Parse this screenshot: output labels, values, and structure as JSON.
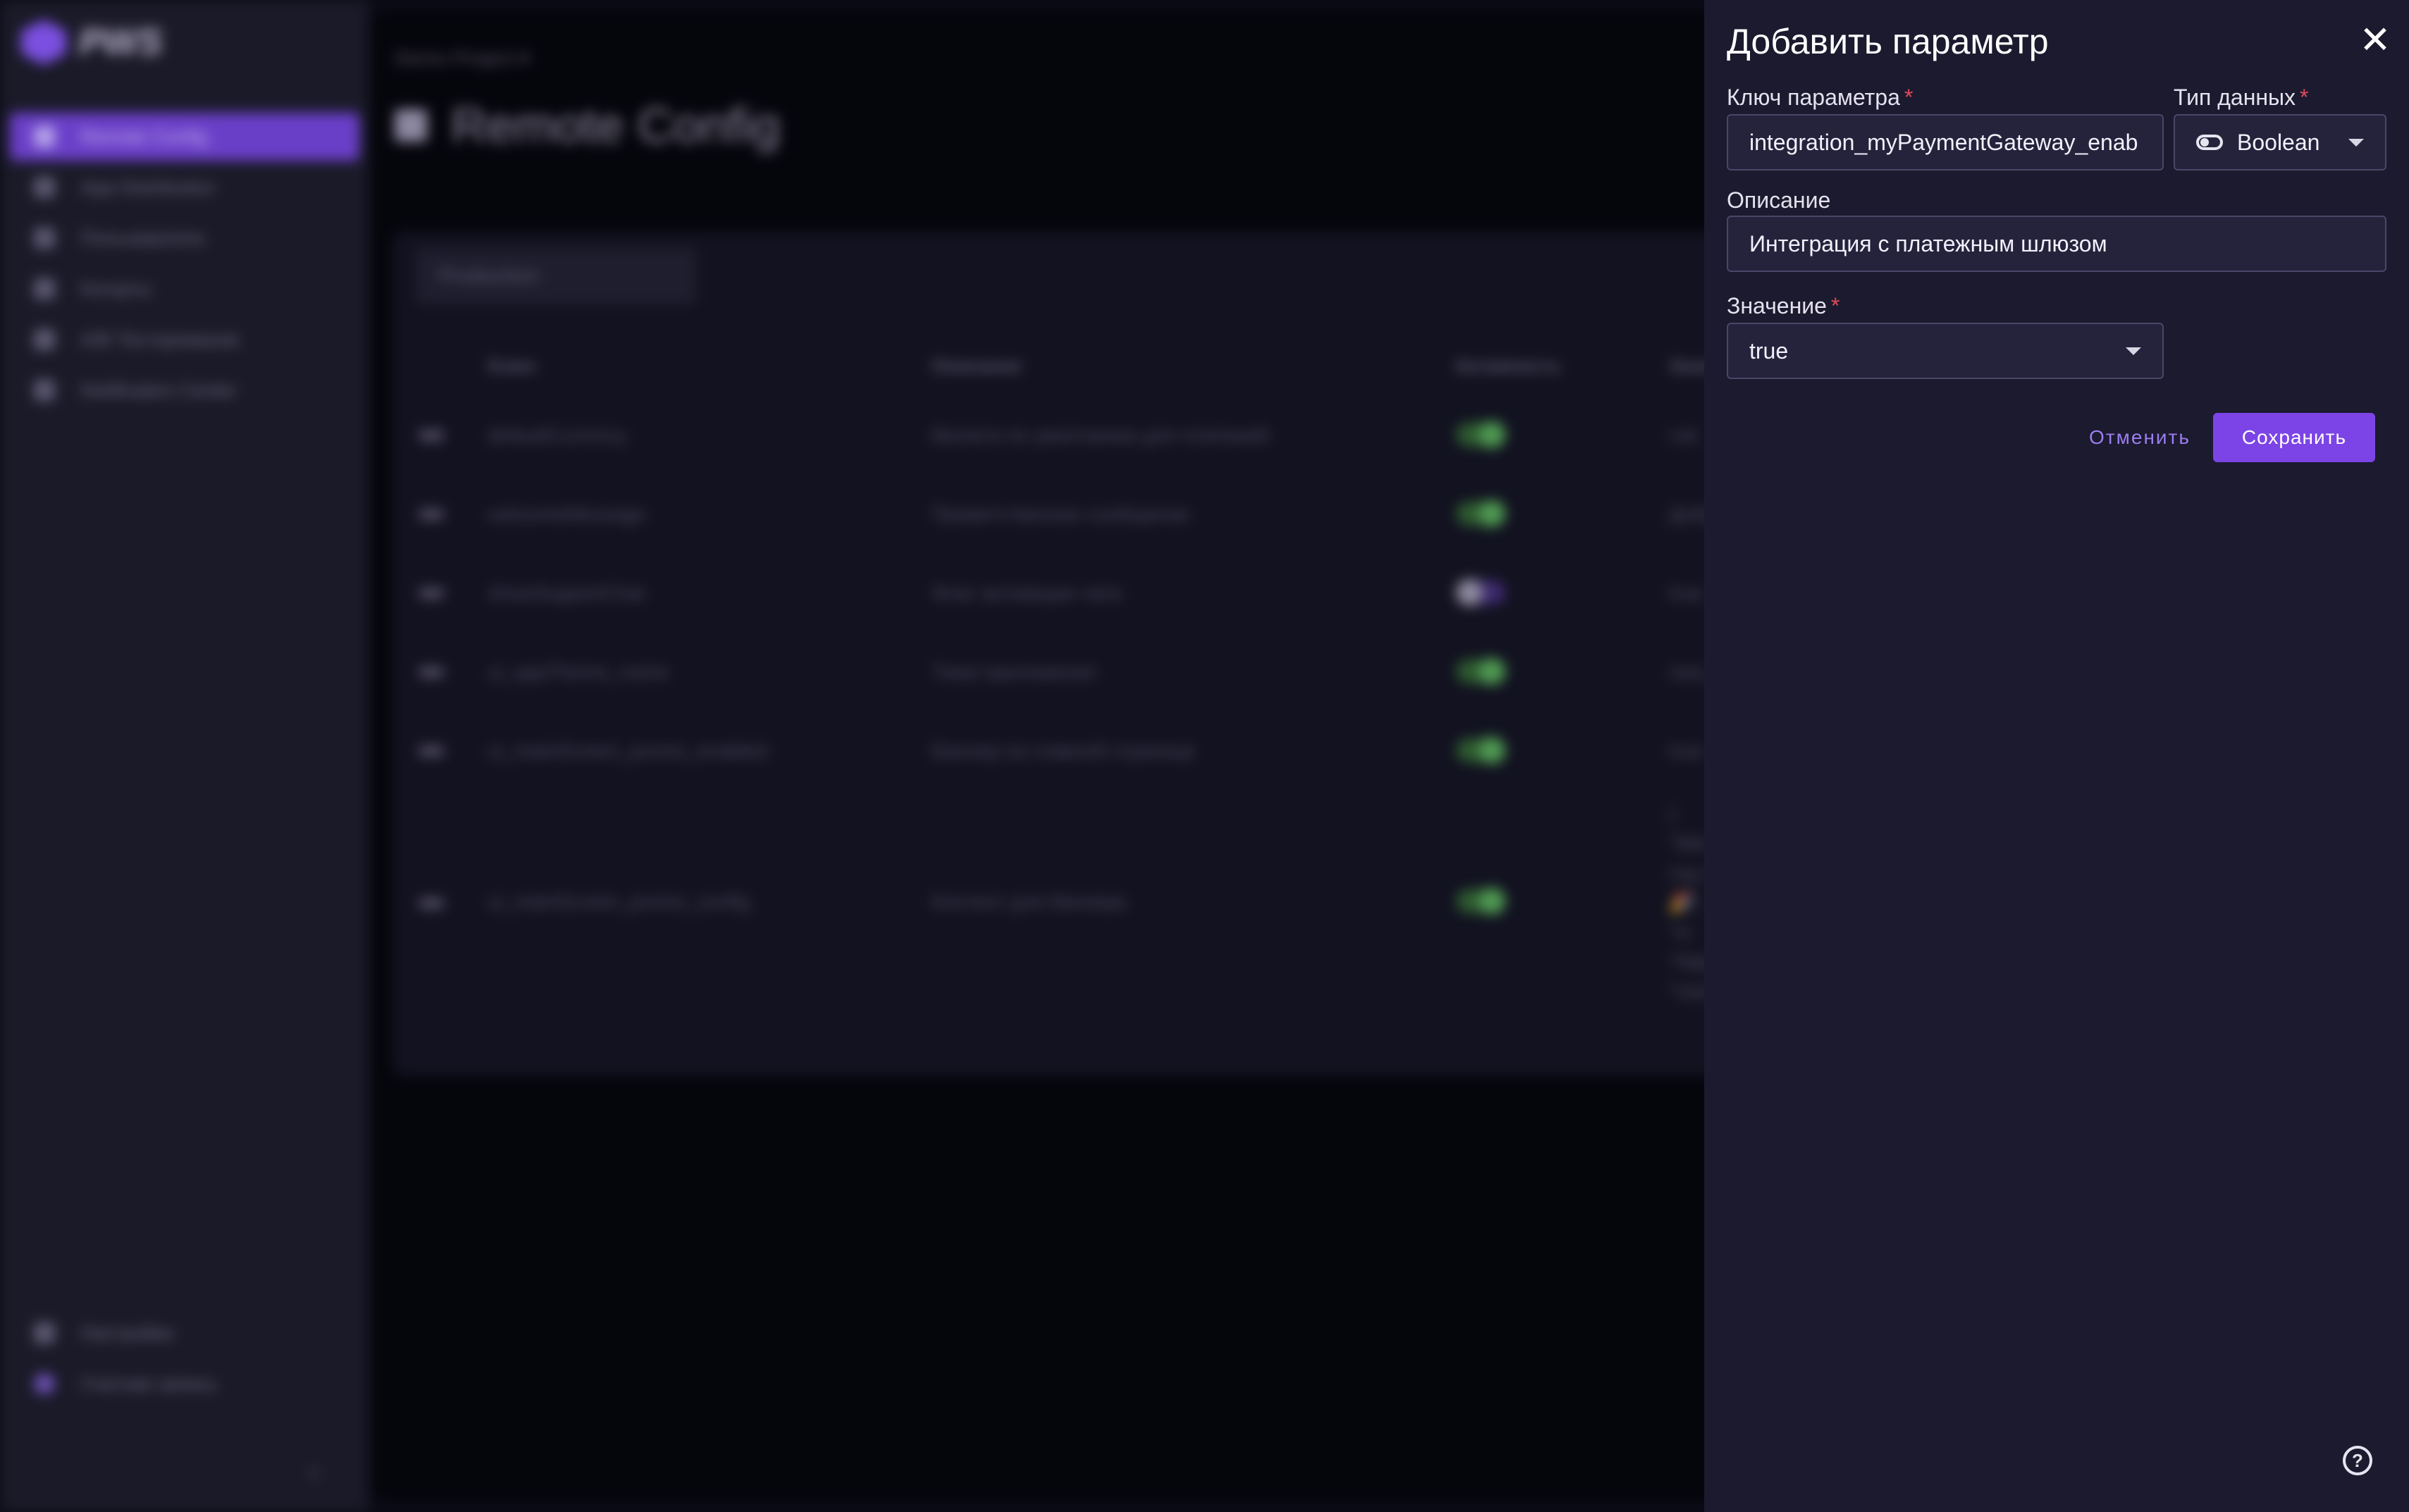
{
  "background": {
    "logo": "PWS",
    "nav": [
      {
        "label": "Remote Config",
        "icon": "remote-config-icon",
        "active": true
      },
      {
        "label": "App Distribution",
        "icon": "app-distribution-icon"
      },
      {
        "label": "Пользователи",
        "icon": "users-icon"
      },
      {
        "label": "Когорты",
        "icon": "cohorts-icon"
      },
      {
        "label": "A/B Тестирование",
        "icon": "ab-test-icon"
      },
      {
        "label": "Notification Center",
        "icon": "notification-icon"
      }
    ],
    "nav_bottom": [
      {
        "label": "Настройки",
        "icon": "settings-icon"
      },
      {
        "label": "Учетная запись",
        "icon": "account-avatar-icon"
      }
    ],
    "breadcrumb": "Demo Project ▾",
    "page_title": "Remote Config",
    "environment": "Production",
    "columns": [
      "Ключ",
      "Описание",
      "Активность",
      "Значе"
    ],
    "rows": [
      {
        "key": "defaultCurrency",
        "description": "Валюта по умолчанию для платежей",
        "active": true,
        "value": "rub"
      },
      {
        "key": "welcomeMessage",
        "description": "Приветственное сообщение",
        "active": true,
        "value": "Добро"
      },
      {
        "key": "showSupportChat",
        "description": "Флаг активации чата",
        "active": false,
        "value": "true"
      },
      {
        "key": "ui_appTheme_name",
        "description": "Тема приложения",
        "active": true,
        "value": "new_y"
      },
      {
        "key": "ui_mainScreen_promo_enabled",
        "description": "Баннер на главной странице",
        "active": true,
        "value": "true"
      },
      {
        "key": "ui_mainScreen_promo_config",
        "description": "Контент для баннера",
        "active": true,
        "value": "{ \"title\" год пр 🎉\", \"in \"https \"ctaUr \"start \"2026-"
      }
    ]
  },
  "dialog": {
    "title": "Добавить параметр",
    "key_label": "Ключ параметра",
    "key_value": "integration_myPaymentGateway_enab",
    "type_label": "Тип данных",
    "type_value": "Boolean",
    "description_label": "Описание",
    "description_value": "Интеграция с платежным шлюзом",
    "value_label": "Значение",
    "value_value": "true",
    "required_mark": "*",
    "cancel_label": "Отменить",
    "save_label": "Сохранить",
    "help": "?",
    "close": "✕"
  },
  "colors": {
    "accent": "#7c44e6",
    "panel": "#1c1a2e",
    "required": "#e04b5a"
  }
}
